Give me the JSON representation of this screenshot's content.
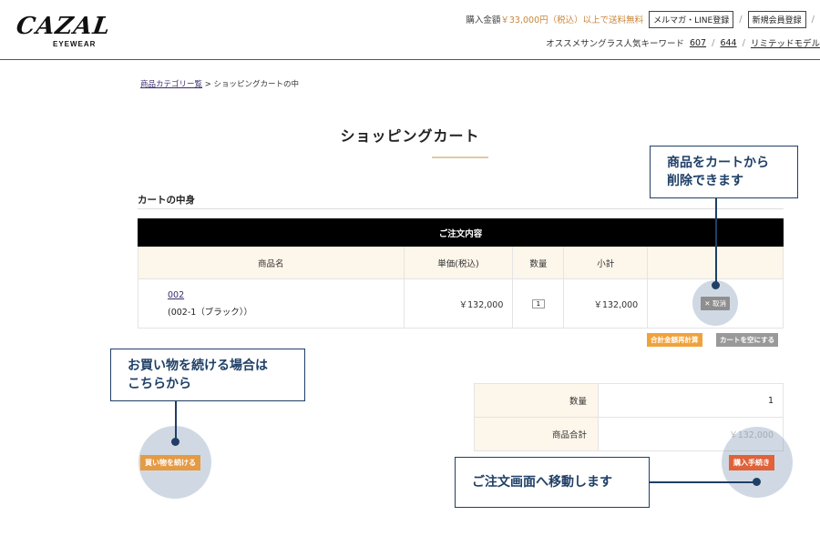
{
  "header": {
    "logo_main": "CAZAL",
    "logo_sub": "EYEWEAR",
    "promo_prefix": "購入金額",
    "promo_amount": "￥33,000円（税込）以上で送料無料",
    "mailmag_label": "メルマガ・LINE登録",
    "slash": "/",
    "register_label": "新規会員登録",
    "keyword_label": "オススメサングラス人気キーワード",
    "keywords": [
      "607",
      "644",
      "リミテッドモデル"
    ]
  },
  "breadcrumb": {
    "link": "商品カテゴリー覧",
    "separator": ">",
    "current": "ショッピングカートの中"
  },
  "page_title": "ショッピングカート",
  "section_label": "カートの中身",
  "cart": {
    "caption": "ご注文内容",
    "headers": [
      "商品名",
      "単価(税込)",
      "数量",
      "小計",
      ""
    ],
    "items": [
      {
        "name": "002",
        "variant": "(002-1（ブラック））",
        "price": "￥132,000",
        "qty": "1",
        "subtotal": "￥132,000",
        "cancel_label": "✕ 取消"
      }
    ],
    "recalc_label": "合計金額再計算",
    "empty_label": "カートを空にする"
  },
  "summary": {
    "qty_label": "数量",
    "qty_value": "1",
    "total_label": "商品合計",
    "total_value": "￥132,000"
  },
  "buttons": {
    "checkout": "購入手続き",
    "continue": "買い物を続ける"
  },
  "callouts": {
    "remove": [
      "商品をカートから",
      "削除できます"
    ],
    "continue": [
      "お買い物を続ける場合は",
      "こちらから"
    ],
    "checkout": "ご注文画面へ移動します"
  },
  "colors": {
    "accent_orange": "#e59a44",
    "checkout_red": "#e0623a",
    "callout_navy": "#1f3f66",
    "header_bg": "#000000"
  }
}
